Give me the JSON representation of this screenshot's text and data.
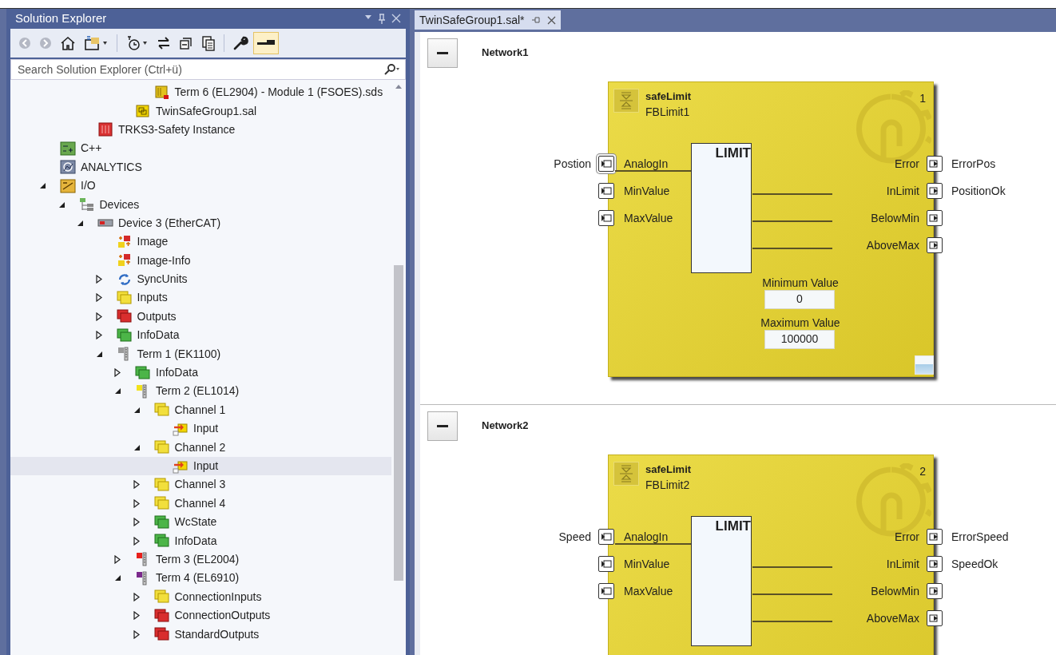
{
  "solution_explorer": {
    "title": "Solution Explorer",
    "toolbar": [
      {
        "kind": "back",
        "disabled": true,
        "on": false
      },
      {
        "kind": "forward",
        "disabled": true,
        "on": false
      },
      {
        "kind": "home",
        "disabled": false,
        "on": false
      },
      {
        "kind": "sync",
        "disabled": false,
        "on": false
      },
      {
        "kind": "history",
        "disabled": false,
        "on": false
      },
      {
        "kind": "switch",
        "disabled": false,
        "on": false
      },
      {
        "kind": "collapse",
        "disabled": false,
        "on": false
      },
      {
        "kind": "showall",
        "disabled": false,
        "on": false
      },
      {
        "kind": "properties",
        "disabled": false,
        "on": false
      },
      {
        "kind": "preview",
        "disabled": false,
        "on": true
      }
    ],
    "search": {
      "placeholder": "Search Solution Explorer (Ctrl+ü)"
    },
    "tree": [
      {
        "children": [
          {
            "children": [
              {
                "children": [
                  {
                    "children": [
                      {
                        "children": [
                          {
                            "label": "Term 6 (EL2904) - Module 1 (FSOES).sds",
                            "kind": "sds",
                            "selected": false
                          }
                        ]
                      },
                      {
                        "label": "TwinSafeGroup1.sal",
                        "kind": "sal",
                        "selected": false
                      }
                    ]
                  }
                ]
              },
              {
                "label": "TRKS3-Safety Instance",
                "kind": "instance",
                "selected": false
              }
            ]
          }
        ]
      },
      {
        "label": "C++",
        "kind": "cpp",
        "selected": false
      },
      {
        "label": "ANALYTICS",
        "kind": "analytics",
        "selected": false
      },
      {
        "label": "I/O",
        "kind": "io",
        "selected": false,
        "expanded": true,
        "children": [
          {
            "label": "Devices",
            "kind": "devices",
            "selected": false,
            "expanded": true,
            "children": [
              {
                "label": "Device 3 (EtherCAT)",
                "kind": "device",
                "selected": false,
                "expanded": true,
                "children": [
                  {
                    "label": "Image",
                    "kind": "image",
                    "selected": false
                  },
                  {
                    "label": "Image-Info",
                    "kind": "image",
                    "selected": false
                  },
                  {
                    "label": "SyncUnits",
                    "kind": "syncunits",
                    "selected": false,
                    "expanded": false
                  },
                  {
                    "label": "Inputs",
                    "kind": "inputs",
                    "selected": false,
                    "expanded": false
                  },
                  {
                    "label": "Outputs",
                    "kind": "outputs",
                    "selected": false,
                    "expanded": false
                  },
                  {
                    "label": "InfoData",
                    "kind": "infodata",
                    "selected": false,
                    "expanded": false
                  },
                  {
                    "label": "Term 1 (EK1100)",
                    "kind": "terminal",
                    "color": "#9a9a9a",
                    "selected": false,
                    "expanded": true,
                    "children": [
                      {
                        "label": "InfoData",
                        "kind": "infodata",
                        "selected": false,
                        "expanded": false
                      },
                      {
                        "label": "Term 2 (EL1014)",
                        "kind": "terminal",
                        "color": "#f2e21c",
                        "selected": false,
                        "expanded": true,
                        "children": [
                          {
                            "label": "Channel 1",
                            "kind": "inputs",
                            "selected": false,
                            "expanded": true,
                            "children": [
                              {
                                "label": "Input",
                                "kind": "variable",
                                "selected": false
                              }
                            ]
                          },
                          {
                            "label": "Channel 2",
                            "kind": "inputs",
                            "selected": false,
                            "expanded": true,
                            "children": [
                              {
                                "label": "Input",
                                "kind": "variable",
                                "selected": true
                              }
                            ]
                          },
                          {
                            "label": "Channel 3",
                            "kind": "inputs",
                            "selected": false,
                            "expanded": false
                          },
                          {
                            "label": "Channel 4",
                            "kind": "inputs",
                            "selected": false,
                            "expanded": false
                          },
                          {
                            "label": "WcState",
                            "kind": "infodata",
                            "selected": false,
                            "expanded": false
                          },
                          {
                            "label": "InfoData",
                            "kind": "infodata",
                            "selected": false,
                            "expanded": false
                          }
                        ]
                      },
                      {
                        "label": "Term 3 (EL2004)",
                        "kind": "terminal",
                        "color": "#e8201c",
                        "selected": false,
                        "expanded": false
                      },
                      {
                        "label": "Term 4 (EL6910)",
                        "kind": "terminal",
                        "color": "#7b2a8c",
                        "selected": false,
                        "expanded": true,
                        "children": [
                          {
                            "label": "ConnectionInputs",
                            "kind": "inputs",
                            "selected": false,
                            "expanded": false
                          },
                          {
                            "label": "ConnectionOutputs",
                            "kind": "outputs",
                            "selected": false,
                            "expanded": false
                          },
                          {
                            "label": "StandardOutputs",
                            "kind": "outputs",
                            "selected": false,
                            "expanded": false
                          }
                        ]
                      }
                    ]
                  }
                ]
              }
            ]
          }
        ]
      }
    ]
  },
  "editor": {
    "tabs": [
      {
        "label": "TwinSafeGroup1.sal*",
        "selected": true
      }
    ],
    "networks": [
      {
        "title": "Network1",
        "expanded": true,
        "block": {
          "type": "safeLimit",
          "instance": "FBLimit1",
          "number": "1",
          "function": "LIMIT",
          "inputs": [
            {
              "port": "AnalogIn",
              "variable": "Postion",
              "wired": true,
              "focused": true
            },
            {
              "port": "MinValue",
              "wired": false,
              "focused": false
            },
            {
              "port": "MaxValue",
              "wired": false,
              "focused": false
            }
          ],
          "outputs": [
            {
              "port": "Error",
              "variable": "ErrorPos",
              "wired": false
            },
            {
              "port": "InLimit",
              "variable": "PositionOk",
              "wired": true
            },
            {
              "port": "BelowMin",
              "wired": true
            },
            {
              "port": "AboveMax",
              "wired": true
            }
          ],
          "parameters": [
            {
              "label": "Minimum Value",
              "value": "0"
            },
            {
              "label": "Maximum Value",
              "value": "100000"
            }
          ]
        }
      },
      {
        "title": "Network2",
        "expanded": true,
        "block": {
          "type": "safeLimit",
          "instance": "FBLimit2",
          "number": "2",
          "function": "LIMIT",
          "inputs": [
            {
              "port": "AnalogIn",
              "variable": "Speed",
              "wired": true,
              "focused": false
            },
            {
              "port": "MinValue",
              "wired": false,
              "focused": false
            },
            {
              "port": "MaxValue",
              "wired": false,
              "focused": false
            }
          ],
          "outputs": [
            {
              "port": "Error",
              "variable": "ErrorSpeed",
              "wired": false
            },
            {
              "port": "InLimit",
              "variable": "SpeedOk",
              "wired": true
            },
            {
              "port": "BelowMin",
              "wired": true
            },
            {
              "port": "AboveMax",
              "wired": true
            }
          ]
        }
      }
    ]
  }
}
